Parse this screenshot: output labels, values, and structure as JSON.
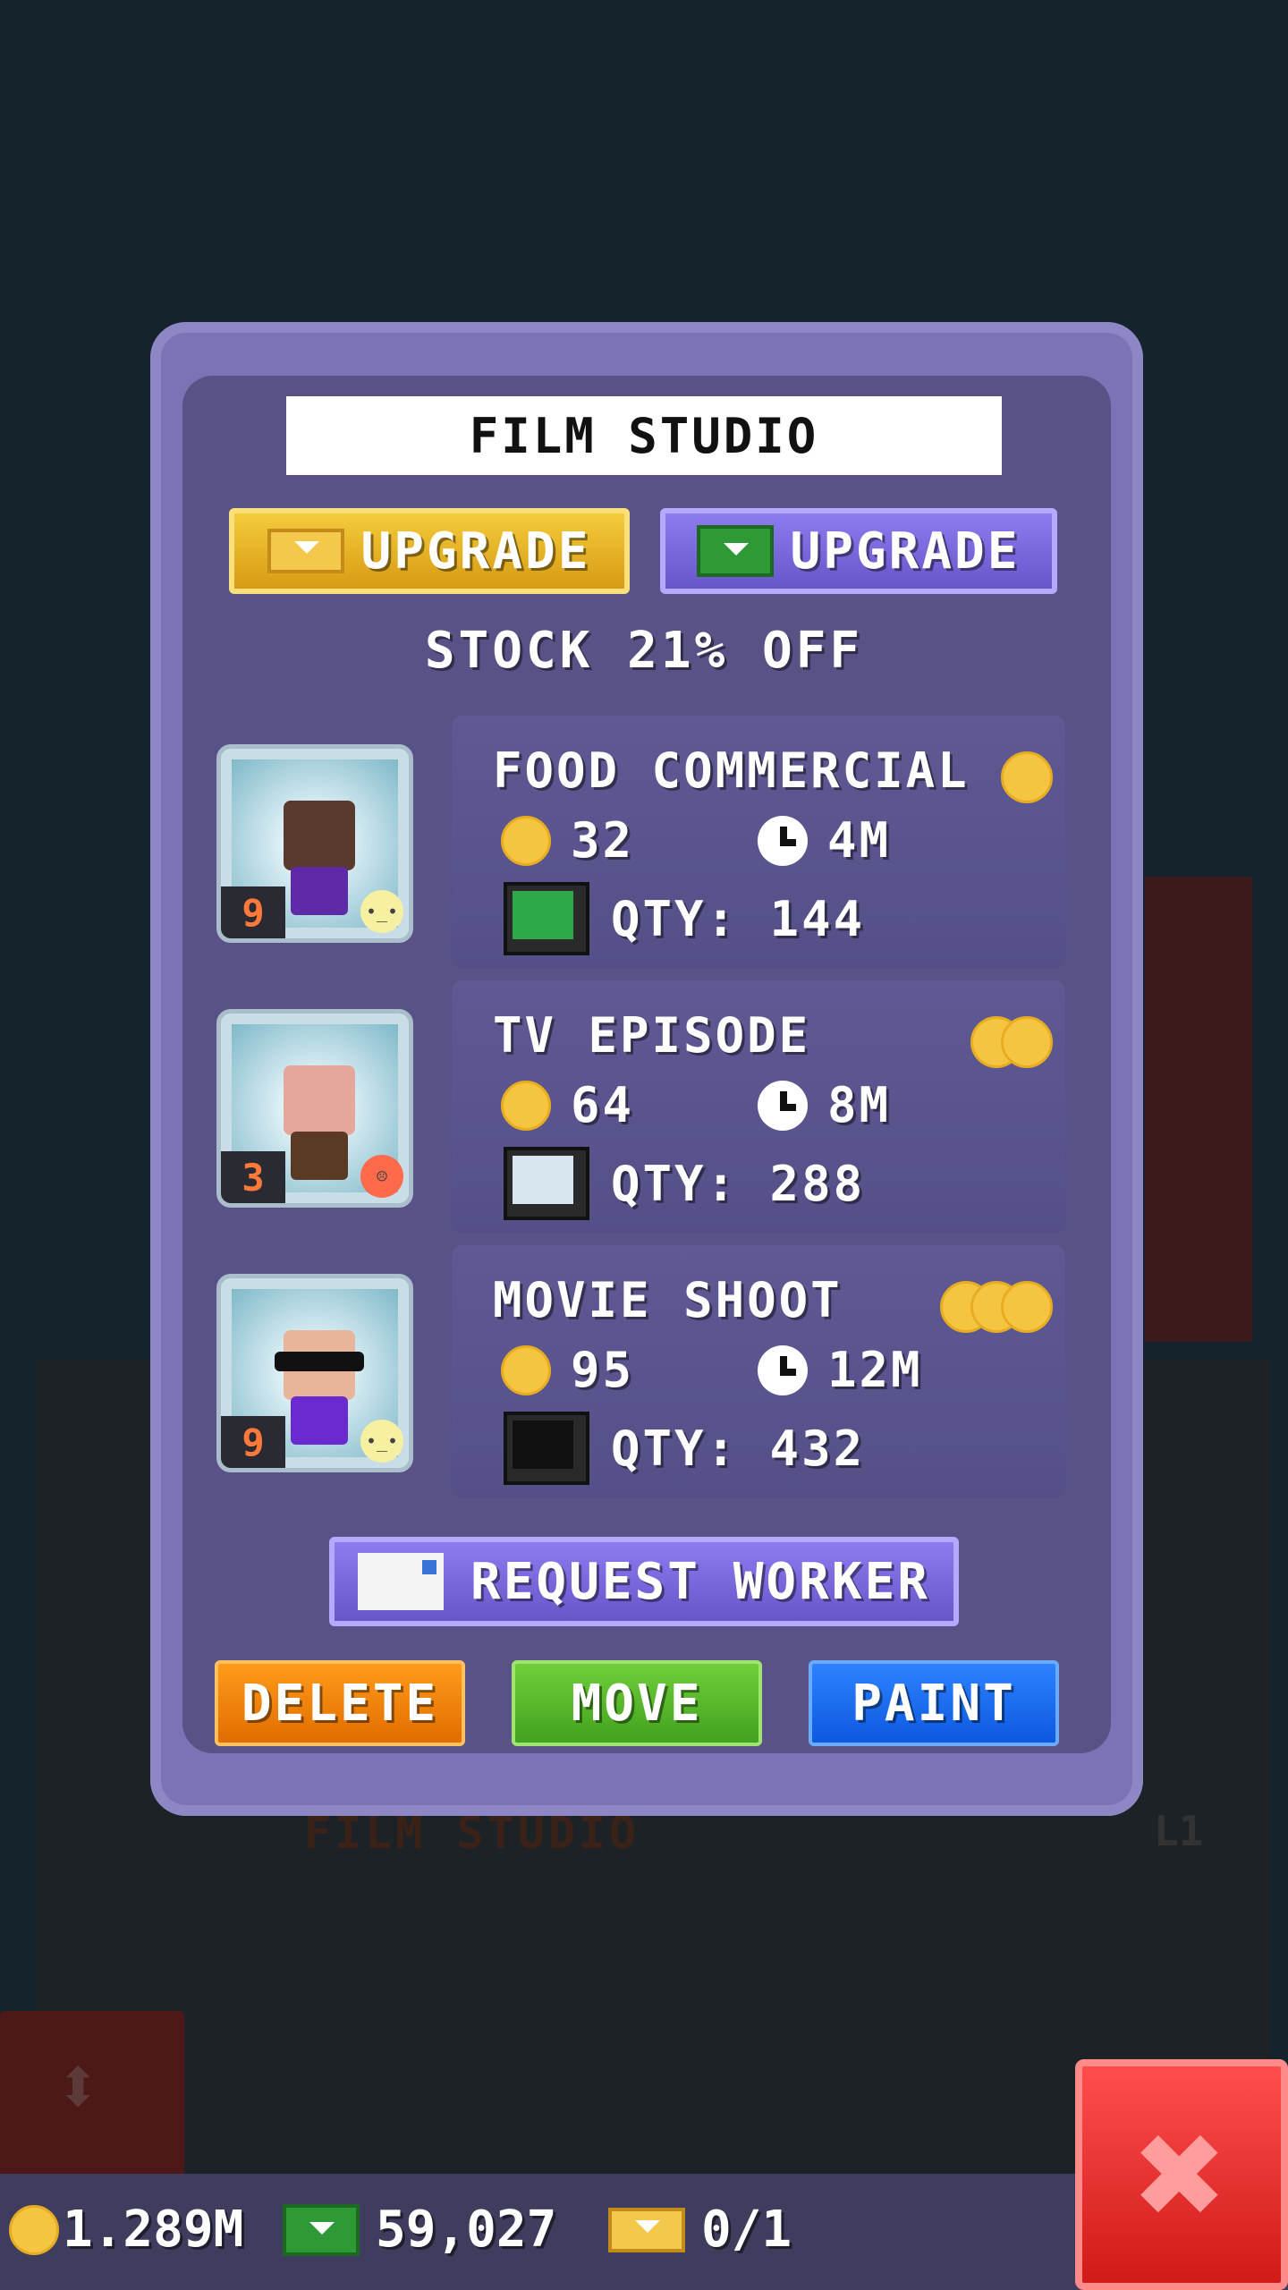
{
  "dialog": {
    "title": "FILM STUDIO",
    "upgrade_coins_label": "UPGRADE",
    "upgrade_bux_label": "UPGRADE",
    "stock_discount": "STOCK 21% OFF"
  },
  "products": [
    {
      "name": "FOOD COMMERCIAL",
      "stars": 1,
      "cost": "32",
      "time": "4M",
      "qty": "QTY: 144",
      "worker_level": "9",
      "worker_mood": "neutral",
      "mood_color": "#f6f1a0",
      "skin": "#5a3a2e",
      "shirt": "#5e2aa8",
      "screen_color": "#2fa84a"
    },
    {
      "name": "TV EPISODE",
      "stars": 2,
      "cost": "64",
      "time": "8M",
      "qty": "QTY: 288",
      "worker_level": "3",
      "worker_mood": "sad",
      "mood_color": "#ff6a4a",
      "skin": "#e4a79a",
      "shirt": "#5a3a22",
      "screen_color": "#d8e6f0"
    },
    {
      "name": "MOVIE SHOOT",
      "stars": 3,
      "cost": "95",
      "time": "12M",
      "qty": "QTY: 432",
      "worker_level": "9",
      "worker_mood": "neutral",
      "mood_color": "#f6f1a0",
      "skin": "#e8b49a",
      "shirt": "#6a2ad0",
      "screen_color": "#111111"
    }
  ],
  "actions": {
    "request_worker": "REQUEST WORKER",
    "delete": "DELETE",
    "move": "MOVE",
    "paint": "PAINT"
  },
  "background": {
    "floor_label": "FILM STUDIO",
    "floor_level": "L1"
  },
  "hud": {
    "coins": "1.289M",
    "bux": "59,027",
    "tickets": "0/1"
  },
  "icons": {
    "coin": "coin-icon",
    "clock": "clock-icon",
    "bux": "bux-icon",
    "ticket": "ticket-icon",
    "close": "close-icon"
  }
}
